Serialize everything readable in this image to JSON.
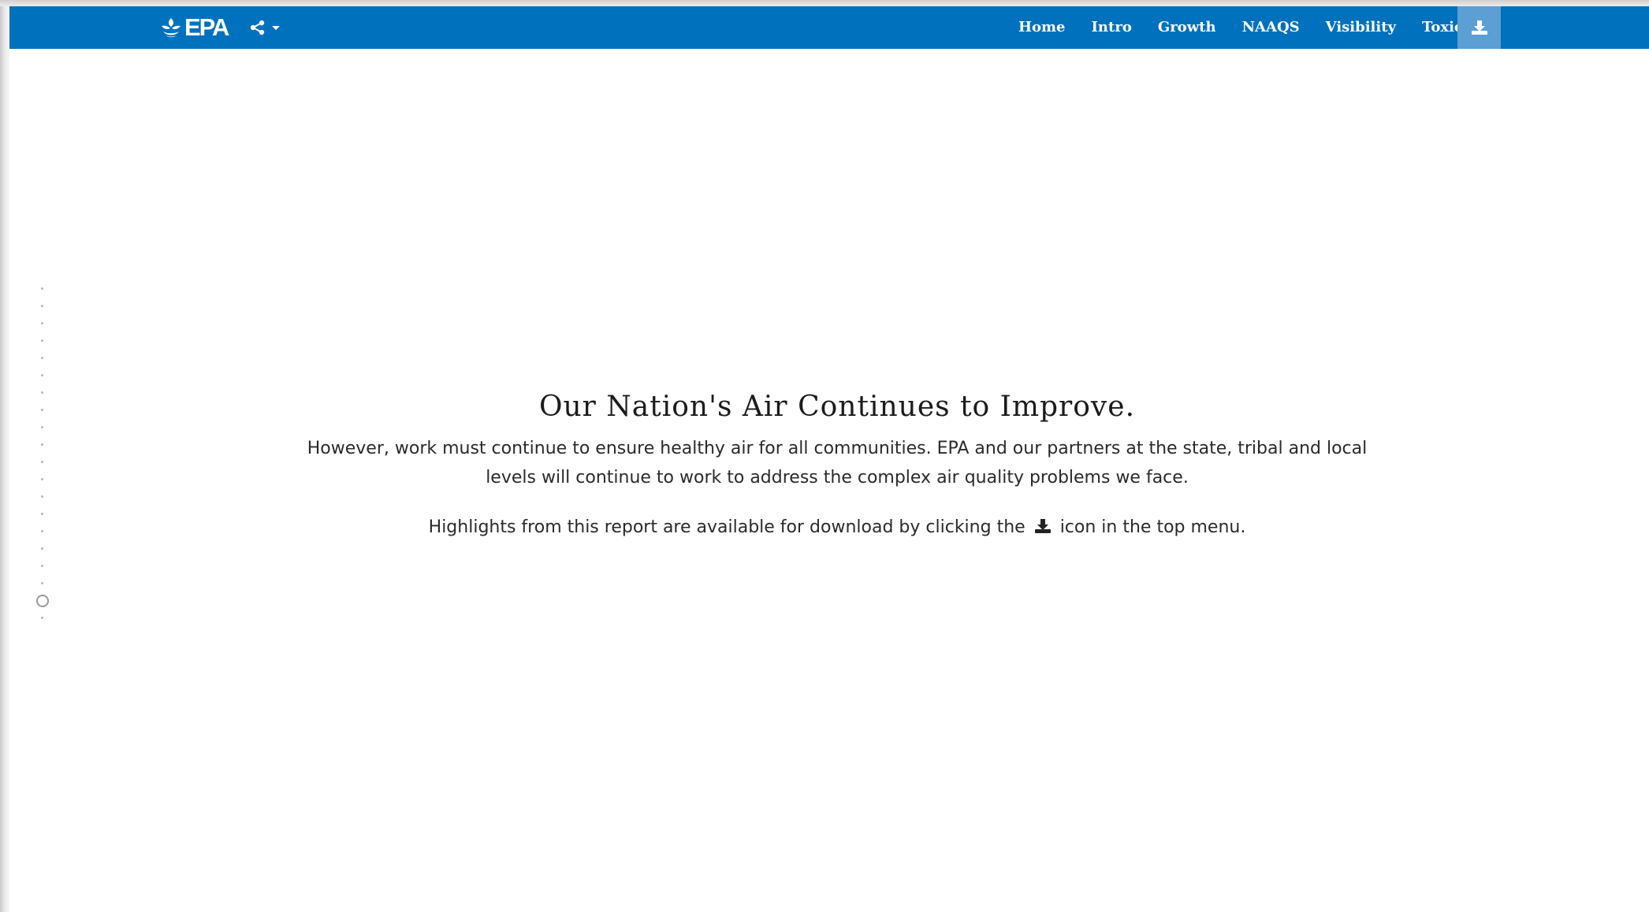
{
  "navbar": {
    "logo_text": "EPA",
    "logo_icon": "epa-flower-icon",
    "share_icon": "share-icon",
    "share_caret_icon": "caret-down-icon",
    "links": [
      {
        "label": "Home"
      },
      {
        "label": "Intro"
      },
      {
        "label": "Growth"
      },
      {
        "label": "NAAQS"
      },
      {
        "label": "Visibility"
      },
      {
        "label": "Toxics"
      }
    ],
    "download_icon": "download-icon",
    "colors": {
      "navbar_bg": "#0071bc",
      "download_bg": "#5b9fd4"
    }
  },
  "side_nav": {
    "dot_count": 20,
    "active_index": 18
  },
  "main": {
    "headline": "Our Nation's Air Continues to Improve.",
    "paragraph1": "However, work must continue to ensure healthy air for all communities. EPA and our partners at the state, tribal and local levels will continue to work to address the complex air quality problems we face.",
    "paragraph2_before_icon": "Highlights from this report are available for download by clicking the",
    "paragraph2_after_icon": "icon in the top menu.",
    "inline_icon": "download-icon"
  }
}
